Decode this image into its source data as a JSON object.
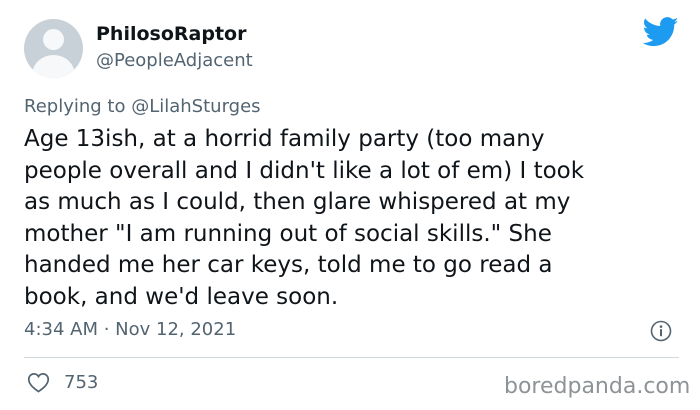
{
  "author": {
    "display_name": "PhilosoRaptor",
    "handle": "@PeopleAdjacent"
  },
  "reply": {
    "prefix": "Replying to ",
    "mention": "@LilahSturges"
  },
  "tweet": {
    "text": "Age 13ish, at a horrid family party (too many\npeople overall and I didn't like a lot of em) I took\nas much as I could, then glare whispered at my\nmother \"I am running out of social skills.\" She\nhanded me her car keys, told me to go read a\nbook, and we'd leave soon.",
    "timestamp": "4:34 AM · Nov 12, 2021",
    "likes": "753"
  },
  "watermark": "boredpanda.com",
  "icons": {
    "brand": "twitter-bird-icon",
    "info": "info-icon",
    "like": "heart-icon"
  },
  "colors": {
    "brand": "#1d9bf0",
    "text": "#0f1419",
    "secondary": "#536471",
    "divider": "#cfd9de"
  }
}
